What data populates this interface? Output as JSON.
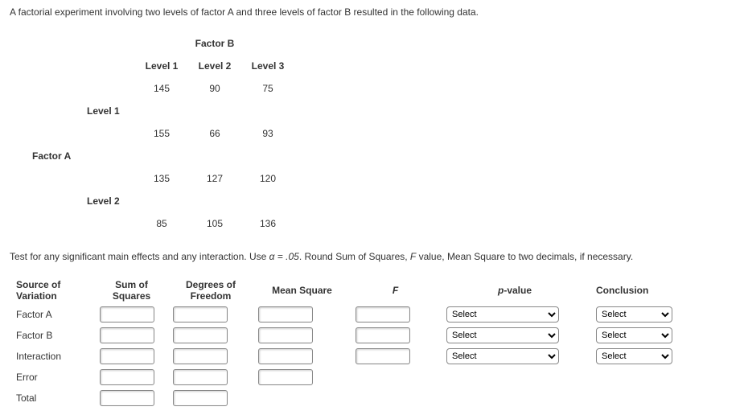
{
  "intro": "A factorial experiment involving two levels of factor A and three levels of factor B resulted in the following data.",
  "factorB_title": "Factor B",
  "factorA_title": "Factor A",
  "b_levels": [
    "Level 1",
    "Level 2",
    "Level 3"
  ],
  "a_levels": [
    "Level 1",
    "Level 2"
  ],
  "data_rows": [
    [
      "145",
      "90",
      "75"
    ],
    [
      "155",
      "66",
      "93"
    ],
    [
      "135",
      "127",
      "120"
    ],
    [
      "85",
      "105",
      "136"
    ]
  ],
  "instruction_pre": "Test for any significant main effects and any interaction. Use ",
  "alpha_expr": "α = .05",
  "instruction_post": ". Round Sum of Squares, ",
  "instruction_ital": "F",
  "instruction_tail": " value, Mean Square to two decimals, if necessary.",
  "anova": {
    "headers": {
      "source": "Source of Variation",
      "ss": "Sum of Squares",
      "df": "Degrees of Freedom",
      "ms": "Mean Square",
      "f": "F",
      "p": "p-value",
      "conc": "Conclusion"
    },
    "rows": [
      "Factor A",
      "Factor B",
      "Interaction",
      "Error",
      "Total"
    ],
    "select_placeholder": "Select"
  }
}
